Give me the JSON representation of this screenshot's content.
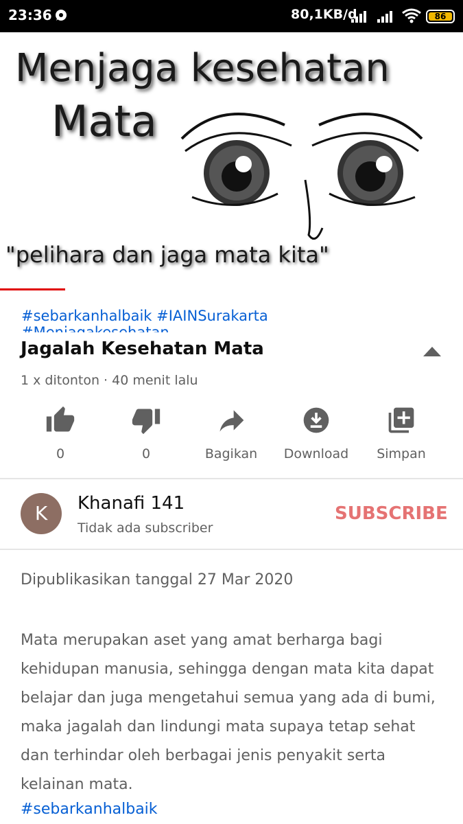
{
  "status_bar": {
    "time": "23:36",
    "speed": "80,1KB/d",
    "battery": "86",
    "icons": [
      "chat-notification-icon",
      "signal-icon",
      "signal-icon",
      "wifi-icon",
      "battery-icon"
    ]
  },
  "thumbnail": {
    "title_line1": "Menjaga kesehatan",
    "title_line2": "Mata",
    "quote": "\"pelihara dan jaga mata kita\""
  },
  "player": {
    "progress": 0.14,
    "progress_color": "#e00000"
  },
  "hashtags": {
    "line1": "#sebarkanhalbaik #IAINSurakarta",
    "line2": "#Menjagakesehatan"
  },
  "video": {
    "title": "Jagalah Kesehatan Mata",
    "meta": "1 x ditonton · 40 menit lalu"
  },
  "actions": {
    "like_count": "0",
    "dislike_count": "0",
    "share_label": "Bagikan",
    "download_label": "Download",
    "save_label": "Simpan"
  },
  "channel": {
    "avatar_letter": "K",
    "avatar_color": "#8d6e63",
    "name": "Khanafi 141",
    "subscribers": "Tidak ada subscriber",
    "subscribe_label": "SUBSCRIBE",
    "subscribe_color": "#e57373"
  },
  "description": {
    "published": "Dipublikasikan tanggal 27 Mar 2020",
    "body": "Mata merupakan aset yang amat berharga bagi kehidupan manusia, sehingga dengan mata kita dapat belajar dan juga mengetahui semua yang ada di bumi, maka jagalah dan lindungi mata supaya tetap sehat dan terhindar oleh berbagai jenis penyakit serta kelainan mata.",
    "hashtag": "#sebarkanhalbaik"
  },
  "colors": {
    "link": "#065fd4",
    "secondary_text": "#606060"
  }
}
